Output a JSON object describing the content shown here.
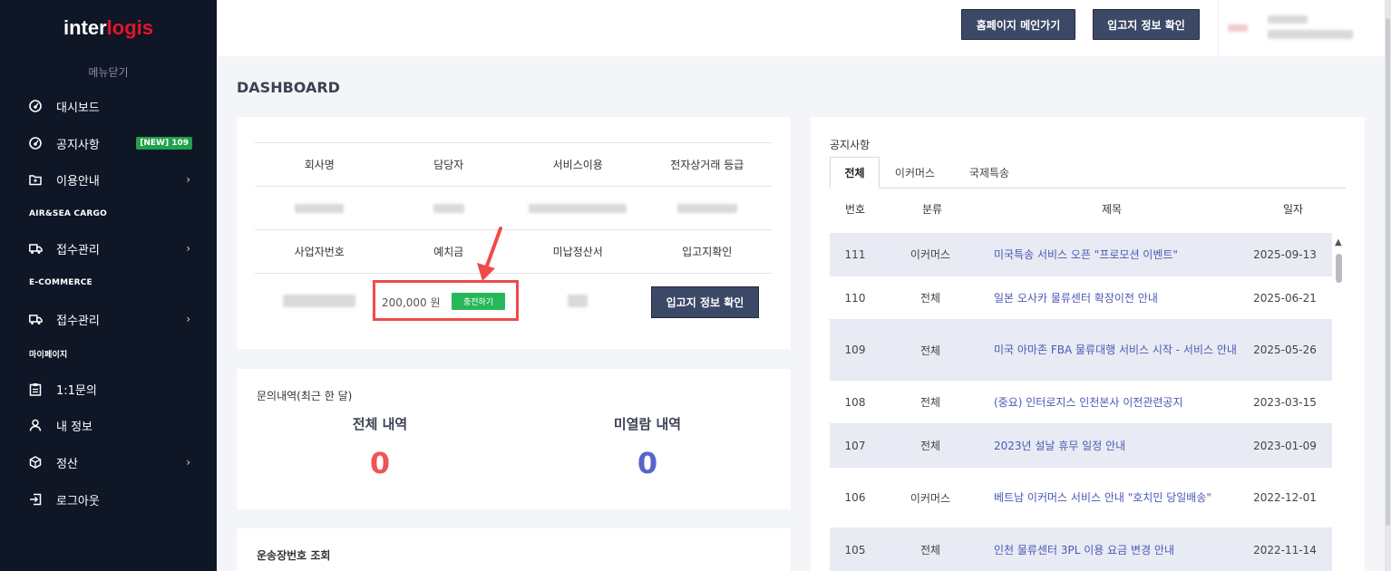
{
  "sidebar": {
    "logo_part1": "inter",
    "logo_part2": "logis",
    "menu_close": "메뉴닫기",
    "items": {
      "dashboard": "대시보드",
      "notice": "공지사항",
      "notice_badge": "[NEW] 109",
      "guide": "이용안내",
      "section_cargo": "AIR&SEA CARGO",
      "cargo_reception": "접수관리",
      "section_ecommerce": "E-COMMERCE",
      "ecommerce_reception": "접수관리",
      "section_mypage": "마이페이지",
      "inquiry": "1:1문의",
      "my_info": "내 정보",
      "settlement": "정산",
      "logout": "로그아웃"
    }
  },
  "topbar": {
    "home_button": "홈페이지 메인가기",
    "warehouse_button": "입고지 정보 확인"
  },
  "page": {
    "title": "DASHBOARD"
  },
  "info": {
    "headers1": [
      "회사명",
      "담당자",
      "서비스이용",
      "전자상거래 등급"
    ],
    "headers2": [
      "사업자번호",
      "예치금",
      "미납정산서",
      "입고지확인"
    ],
    "deposit_amount": "200,000 원",
    "charge_button": "충전하기",
    "confirm_button": "입고지 정보 확인"
  },
  "inquiries": {
    "title": "문의내역(최근 한 달)",
    "total_label": "전체 내역",
    "total_count": "0",
    "unread_label": "미열람 내역",
    "unread_count": "0"
  },
  "waybill": {
    "title": "운송장번호 조회"
  },
  "notices": {
    "title": "공지사항",
    "tabs": [
      "전체",
      "이커머스",
      "국제특송"
    ],
    "columns": [
      "번호",
      "분류",
      "제목",
      "일자"
    ],
    "rows": [
      {
        "no": "111",
        "cat": "이커머스",
        "title": "미국특송 서비스 오픈 \"프로모션 이벤트\"",
        "date": "2025-09-13"
      },
      {
        "no": "110",
        "cat": "전체",
        "title": "일본 오사카 물류센터 확장이전 안내",
        "date": "2025-06-21"
      },
      {
        "no": "109",
        "cat": "전체",
        "title": "미국 아마존 FBA 물류대행 서비스 시작 - 서비스 안내",
        "date": "2025-05-26"
      },
      {
        "no": "108",
        "cat": "전체",
        "title": "(중요) 인터로지스 인천본사 이전관련공지",
        "date": "2023-03-15"
      },
      {
        "no": "107",
        "cat": "전체",
        "title": "2023년 설날 휴무 일정 안내",
        "date": "2023-01-09"
      },
      {
        "no": "106",
        "cat": "이커머스",
        "title": "베트남 이커머스 서비스 안내 \"호치민 당일배송\"",
        "date": "2022-12-01"
      },
      {
        "no": "105",
        "cat": "전체",
        "title": "인천 물류센터 3PL 이용 요금 변경 안내",
        "date": "2022-11-14"
      }
    ]
  },
  "colors": {
    "sidebar_bg": "#0f1626",
    "button_navy": "#3b4866",
    "accent_red": "#f04a4a",
    "accent_blue": "#5565c8",
    "charge_green": "#27b85a"
  }
}
